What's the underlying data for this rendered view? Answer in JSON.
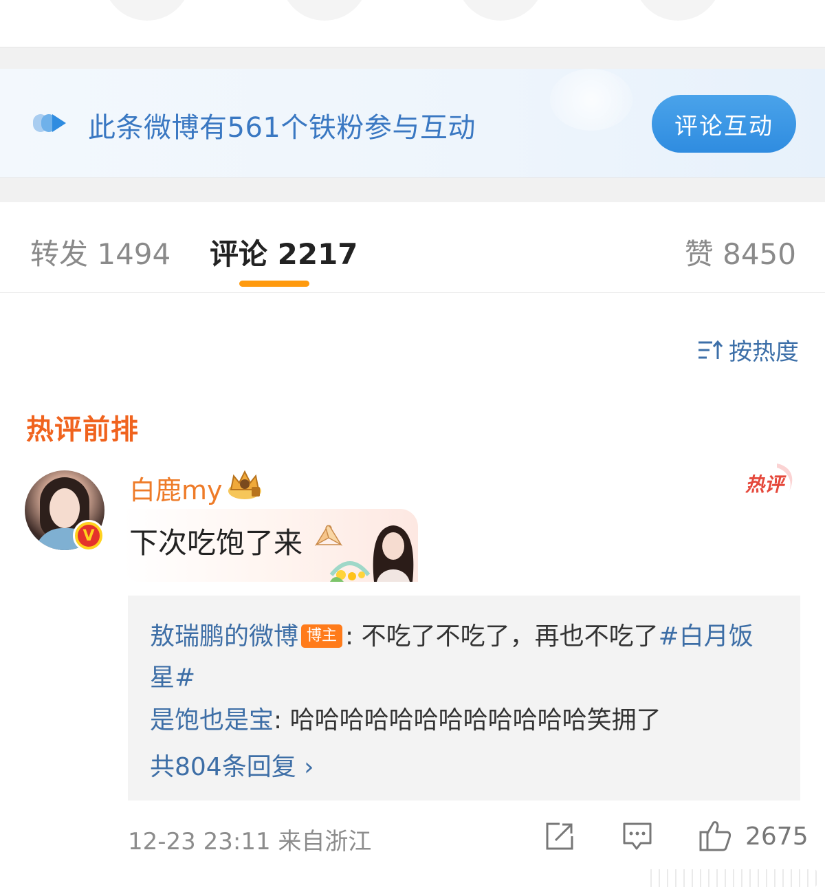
{
  "fans_banner": {
    "text": "此条微博有561个铁粉参与互动",
    "button_label": "评论互动"
  },
  "tabs": {
    "repost": "转发 1494",
    "comment": "评论 2217",
    "like": "赞 8450",
    "active": "comment"
  },
  "sort": {
    "label": "按热度"
  },
  "hot_section": {
    "title": "热评前排"
  },
  "comment": {
    "username": "白鹿my",
    "text": "下次吃饱了来",
    "hot_badge": "热评",
    "replies": [
      {
        "author": "敖瑞鹏的微博",
        "tag": "博主",
        "separator": ": ",
        "text": "不吃了不吃了，再也不吃了",
        "topic": "#白月饭星#"
      },
      {
        "author": "是饱也是宝",
        "separator": ": ",
        "text": "哈哈哈哈哈哈哈哈哈哈哈哈笑拥了"
      }
    ],
    "more_replies": "共804条回复 ›",
    "time": "12-23 23:11",
    "location": "来自浙江",
    "like_count": "2675"
  },
  "colors": {
    "accent_orange": "#ff9a0e",
    "username_orange": "#ee7b28",
    "link_blue": "#3d6ea6",
    "button_blue": "#2f8ce0"
  }
}
